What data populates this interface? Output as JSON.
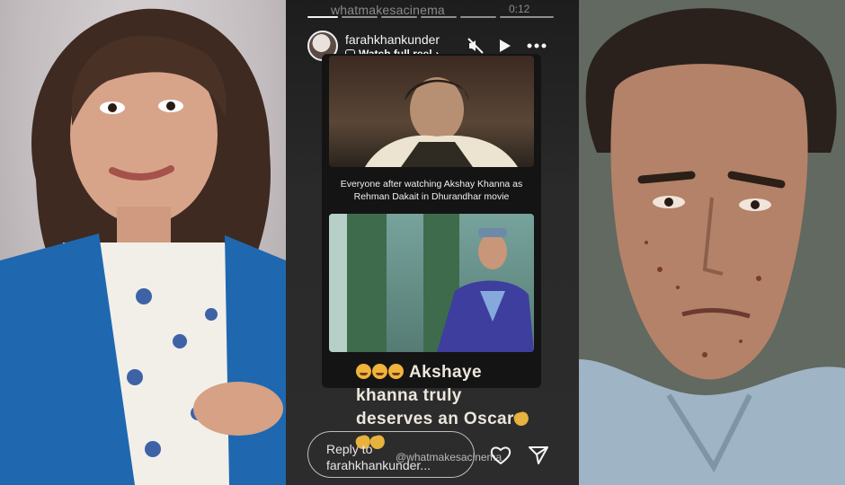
{
  "watermark": "whatmakesacinema",
  "timer": "0:12",
  "story": {
    "username": "farahkhankunder",
    "watch_full_reel": "Watch full reel",
    "caption": "Everyone after watching Akshay Khanna as Rehman Dakait in Dhurandhar movie",
    "overlay_text_line1": "Akshaye",
    "overlay_text_line2": "khanna truly",
    "overlay_text_line3": "deserves an Oscar",
    "reply_line1": "Reply to",
    "reply_line2": "farahkhankunder...",
    "mention": "@whatmakesacinema"
  },
  "icons": {
    "mute": "mute-icon",
    "play": "play-icon",
    "more": "more-icon",
    "like": "heart-icon",
    "share": "send-icon"
  }
}
